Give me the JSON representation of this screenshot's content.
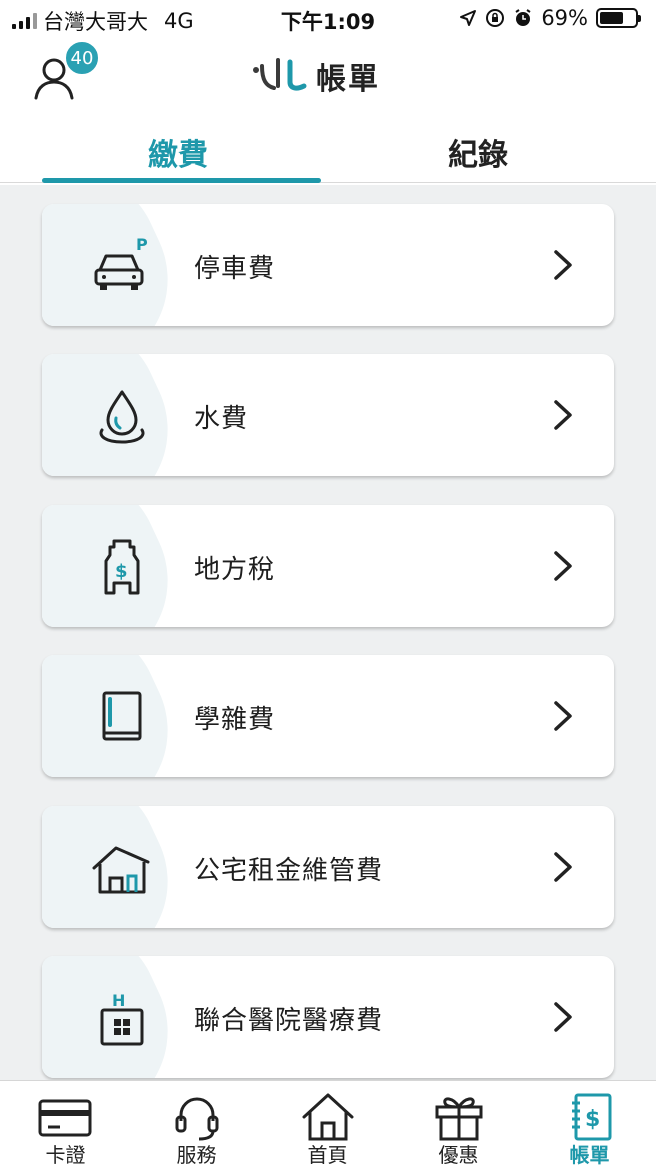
{
  "status_bar": {
    "carrier": "台灣大哥大",
    "network": "4G",
    "time": "下午1:09",
    "battery_percent": "69%",
    "battery_level": 0.69
  },
  "header": {
    "badge_count": "40",
    "title": "帳單"
  },
  "tabs": [
    {
      "label": "繳費",
      "active": true
    },
    {
      "label": "紀錄",
      "active": false
    }
  ],
  "bills": [
    {
      "label": "停車費",
      "icon": "parking-car-icon"
    },
    {
      "label": "水費",
      "icon": "water-drop-icon"
    },
    {
      "label": "地方稅",
      "icon": "tax-building-icon"
    },
    {
      "label": "學雜費",
      "icon": "book-icon"
    },
    {
      "label": "公宅租金維管費",
      "icon": "house-icon"
    },
    {
      "label": "聯合醫院醫療費",
      "icon": "hospital-icon"
    }
  ],
  "bottom_nav": [
    {
      "label": "卡證",
      "icon": "card-icon",
      "active": false
    },
    {
      "label": "服務",
      "icon": "headset-icon",
      "active": false
    },
    {
      "label": "首頁",
      "icon": "home-icon",
      "active": false
    },
    {
      "label": "優惠",
      "icon": "gift-icon",
      "active": false
    },
    {
      "label": "帳單",
      "icon": "bill-icon",
      "active": true
    }
  ],
  "colors": {
    "accent": "#1e98aa",
    "badge": "#2aa1b3",
    "background": "#eef0f1"
  }
}
